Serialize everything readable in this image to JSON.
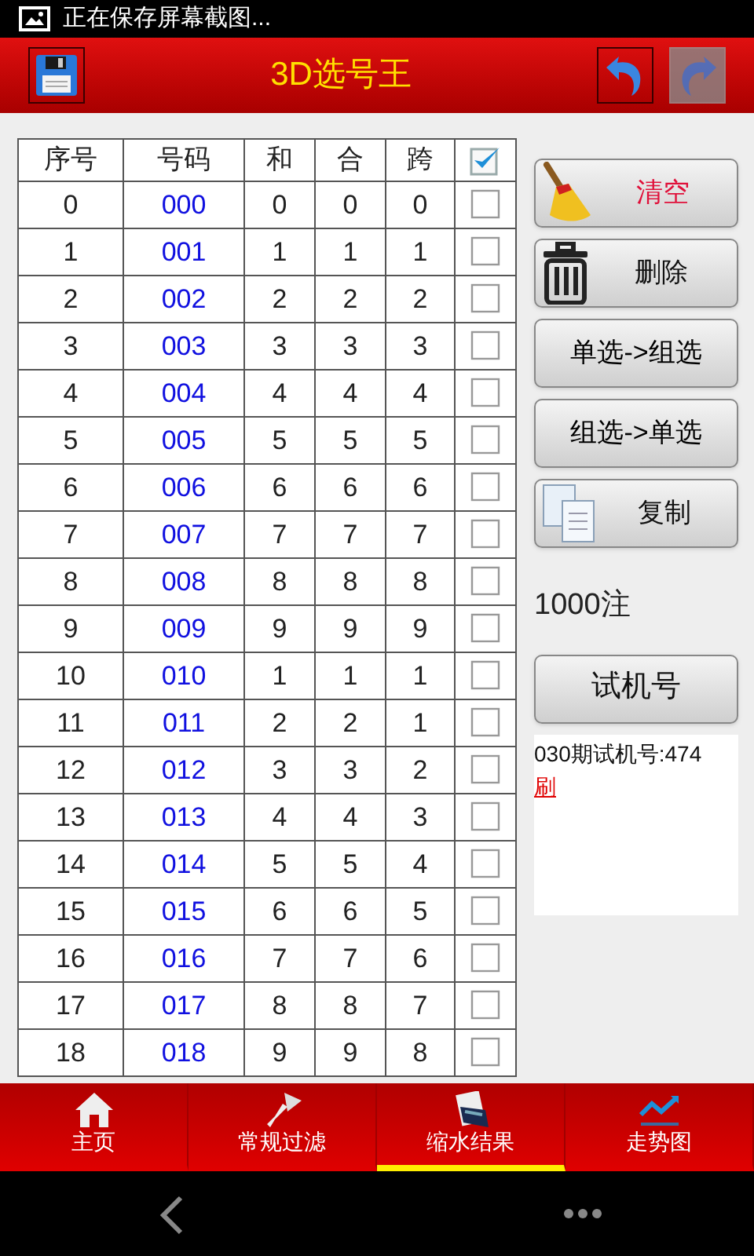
{
  "status_bar": {
    "notification": "正在保存屏幕截图..."
  },
  "app_bar": {
    "title": "3D选号王",
    "actions": [
      {
        "kind": "save",
        "disabled": false
      },
      {
        "kind": "undo",
        "disabled": false
      },
      {
        "kind": "redo",
        "disabled": true
      }
    ]
  },
  "table": {
    "columns": [
      "序号",
      "号码",
      "和",
      "合",
      "跨"
    ],
    "all_checked": true,
    "rows": [
      {
        "index": "0",
        "number": "000",
        "sum": "0",
        "he": "0",
        "span": "0",
        "checked": false
      },
      {
        "index": "1",
        "number": "001",
        "sum": "1",
        "he": "1",
        "span": "1",
        "checked": false
      },
      {
        "index": "2",
        "number": "002",
        "sum": "2",
        "he": "2",
        "span": "2",
        "checked": false
      },
      {
        "index": "3",
        "number": "003",
        "sum": "3",
        "he": "3",
        "span": "3",
        "checked": false
      },
      {
        "index": "4",
        "number": "004",
        "sum": "4",
        "he": "4",
        "span": "4",
        "checked": false
      },
      {
        "index": "5",
        "number": "005",
        "sum": "5",
        "he": "5",
        "span": "5",
        "checked": false
      },
      {
        "index": "6",
        "number": "006",
        "sum": "6",
        "he": "6",
        "span": "6",
        "checked": false
      },
      {
        "index": "7",
        "number": "007",
        "sum": "7",
        "he": "7",
        "span": "7",
        "checked": false
      },
      {
        "index": "8",
        "number": "008",
        "sum": "8",
        "he": "8",
        "span": "8",
        "checked": false
      },
      {
        "index": "9",
        "number": "009",
        "sum": "9",
        "he": "9",
        "span": "9",
        "checked": false
      },
      {
        "index": "10",
        "number": "010",
        "sum": "1",
        "he": "1",
        "span": "1",
        "checked": false
      },
      {
        "index": "11",
        "number": "011",
        "sum": "2",
        "he": "2",
        "span": "1",
        "checked": false
      },
      {
        "index": "12",
        "number": "012",
        "sum": "3",
        "he": "3",
        "span": "2",
        "checked": false
      },
      {
        "index": "13",
        "number": "013",
        "sum": "4",
        "he": "4",
        "span": "3",
        "checked": false
      },
      {
        "index": "14",
        "number": "014",
        "sum": "5",
        "he": "5",
        "span": "4",
        "checked": false
      },
      {
        "index": "15",
        "number": "015",
        "sum": "6",
        "he": "6",
        "span": "5",
        "checked": false
      },
      {
        "index": "16",
        "number": "016",
        "sum": "7",
        "he": "7",
        "span": "6",
        "checked": false
      },
      {
        "index": "17",
        "number": "017",
        "sum": "8",
        "he": "8",
        "span": "7",
        "checked": false
      },
      {
        "index": "18",
        "number": "018",
        "sum": "9",
        "he": "9",
        "span": "8",
        "checked": false
      }
    ]
  },
  "actions": [
    {
      "kind": "clear",
      "label": "清空"
    },
    {
      "kind": "delete",
      "label": "删除"
    },
    {
      "kind": "plain",
      "label": "单选->组选"
    },
    {
      "kind": "plain",
      "label": "组选->单选"
    },
    {
      "kind": "copy",
      "label": "复制"
    }
  ],
  "count": "1000注",
  "trial_button": "试机号",
  "trial_info": {
    "text": "030期试机号:474",
    "link": "刷"
  },
  "bottom_tabs": [
    {
      "kind": "home",
      "label": "主页",
      "selected": false
    },
    {
      "kind": "filter",
      "label": "常规过滤",
      "selected": false
    },
    {
      "kind": "result",
      "label": "缩水结果",
      "selected": true
    },
    {
      "kind": "trend",
      "label": "走势图",
      "selected": false
    }
  ]
}
